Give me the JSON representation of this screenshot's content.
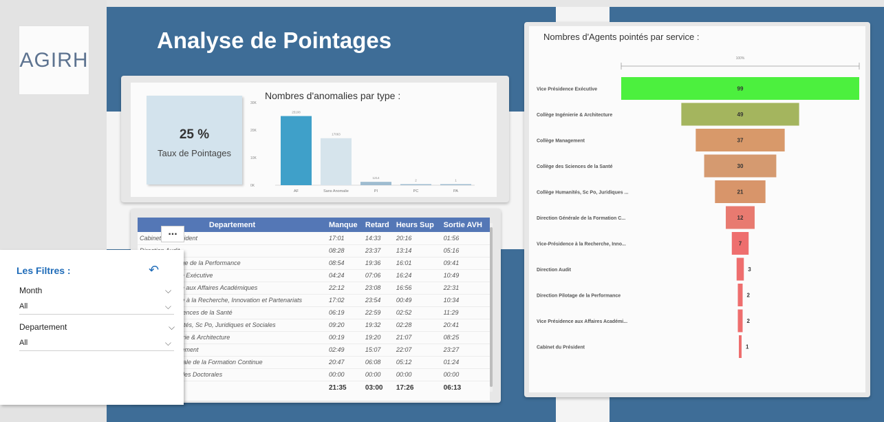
{
  "logo": {
    "text": "AGIRH"
  },
  "header": {
    "title": "Analyse de Pointages"
  },
  "kpi": {
    "value": "25 %",
    "label": "Taux de Pointages"
  },
  "anomalies_chart": {
    "title": "Nombres d'anomalies par type :",
    "chart_data": {
      "type": "bar",
      "categories": [
        "AF",
        "Sans Anomalie",
        "PI",
        "PC",
        "PA"
      ],
      "values": [
        25108,
        17063,
        1214,
        2,
        1
      ],
      "value_labels": [
        "25108",
        "17063",
        "1214",
        "2",
        "1"
      ],
      "yticks": [
        "0K",
        "10K",
        "20K",
        "30K"
      ],
      "ylim": [
        0,
        30000
      ],
      "colors": [
        "#3fa0c9",
        "#d6e4ec",
        "#9fbcd0",
        "#9fbcd0",
        "#9fbcd0"
      ]
    }
  },
  "table": {
    "columns": [
      "Departement",
      "Manque",
      "Retard",
      "Heurs Sup",
      "Sortie AVH"
    ],
    "rows": [
      [
        "Cabinet du Président",
        "17:01",
        "14:33",
        "20:16",
        "01:56"
      ],
      [
        "Direction Audit",
        "08:28",
        "23:37",
        "13:14",
        "05:16"
      ],
      [
        "Direction Pilotage de la Performance",
        "08:54",
        "19:36",
        "16:01",
        "09:41"
      ],
      [
        "Vice Présidence Exécutive",
        "04:24",
        "07:06",
        "16:24",
        "10:49"
      ],
      [
        "Vice Présidence aux Affaires Académiques",
        "22:12",
        "23:08",
        "16:56",
        "22:31"
      ],
      [
        "Vice-Présidence à la Recherche, Innovation et Partenariats",
        "17:02",
        "23:54",
        "00:49",
        "10:34"
      ],
      [
        "Collège des Sciences de la Santé",
        "06:19",
        "22:59",
        "02:52",
        "11:29"
      ],
      [
        "Collège Humanités, Sc Po, Juridiques et Sociales",
        "09:20",
        "19:32",
        "02:28",
        "20:41"
      ],
      [
        "Collège Ingénierie & Architecture",
        "00:19",
        "19:20",
        "21:07",
        "08:25"
      ],
      [
        "Collège Management",
        "02:49",
        "15:07",
        "22:07",
        "23:27"
      ],
      [
        "Direction Générale de la Formation Continue",
        "20:47",
        "06:08",
        "05:12",
        "01:24"
      ],
      [
        "Centre des Etudes Doctorales",
        "00:00",
        "00:00",
        "00:00",
        "00:00"
      ]
    ],
    "totals": [
      "",
      "21:35",
      "03:00",
      "17:26",
      "06:13"
    ],
    "more_label": "..."
  },
  "filters": {
    "title": "Les Filtres :",
    "month_label": "Month",
    "month_value": "All",
    "dept_label": "Departement",
    "dept_value": "All",
    "reset_icon": "undo-icon",
    "chevron": "⌵"
  },
  "funnel_chart": {
    "title": "Nombres d'Agents pointés par service :",
    "top_label": "100%",
    "chart_data": {
      "type": "bar",
      "categories": [
        "Vice Présidence Exécutive",
        "Collège Ingénierie & Architecture",
        "Collège Management",
        "Collège des Sciences de la Santé",
        "Collège Humanités, Sc Po, Juridiques ...",
        "Direction Générale de la Formation C...",
        "Vice-Présidence à la Recherche, Inno...",
        "Direction Audit",
        "Direction Pilotage de la Performance",
        "Vice Présidence aux Affaires Académi...",
        "Cabinet du Président"
      ],
      "values": [
        99,
        49,
        37,
        30,
        21,
        12,
        7,
        3,
        2,
        2,
        1
      ],
      "colors": [
        "#4cf03e",
        "#a4b55e",
        "#d8996a",
        "#d59a70",
        "#d8956a",
        "#e87a70",
        "#ee6e6e",
        "#ee6e6e",
        "#ee6e6e",
        "#ee6e6e",
        "#ee6e6e"
      ]
    }
  }
}
